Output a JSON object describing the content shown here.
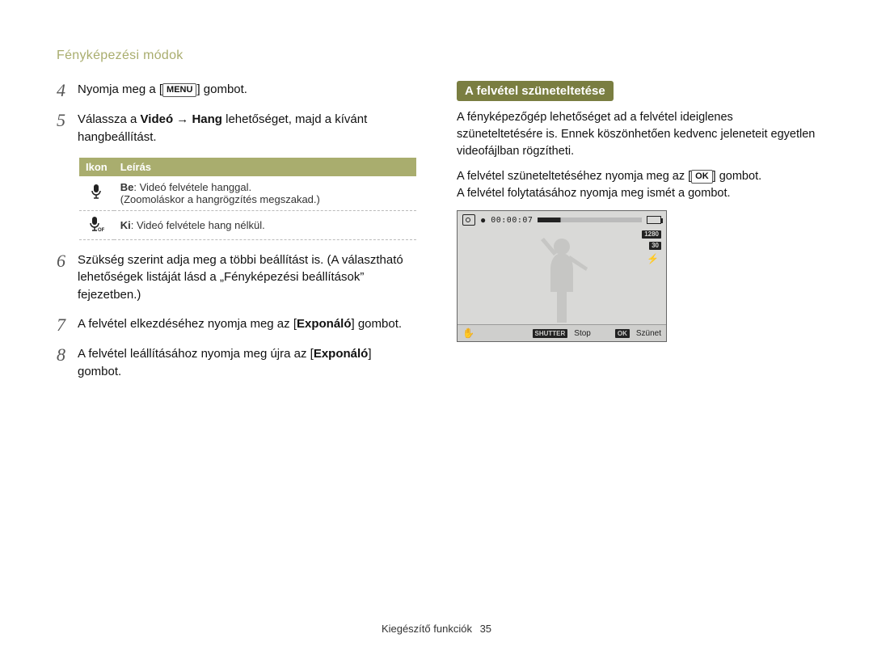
{
  "header": {
    "title": "Fényképezési módok"
  },
  "buttons": {
    "menu": "MENU",
    "ok": "OK"
  },
  "left": {
    "step4": {
      "num": "4",
      "prefix": "Nyomja meg a [",
      "suffix": "] gombot."
    },
    "step5": {
      "num": "5",
      "prefix": "Válassza a ",
      "bold1": "Videó",
      "arrow": " → ",
      "bold2": "Hang",
      "suffix": " lehetőséget, majd a kívánt hangbeállítást."
    },
    "table": {
      "head_icon": "Ikon",
      "head_desc": "Leírás",
      "rows": [
        {
          "icon": "mic-on",
          "bold": "Be",
          "rest": ": Videó felvétele hanggal.",
          "note": "(Zoomoláskor a hangrögzítés megszakad.)"
        },
        {
          "icon": "mic-off",
          "bold": "Ki",
          "rest": ": Videó felvétele hang nélkül."
        }
      ]
    },
    "step6": {
      "num": "6",
      "text": "Szükség szerint adja meg a többi beállítást is. (A választható lehetőségek listáját lásd a „Fényképezési beállítások” fejezetben.)"
    },
    "step7": {
      "num": "7",
      "prefix": "A felvétel elkezdéséhez nyomja meg az [",
      "bold": "Exponáló",
      "suffix": "] gombot."
    },
    "step8": {
      "num": "8",
      "prefix": "A felvétel leállításához nyomja meg újra az [",
      "bold": "Exponáló",
      "suffix": "] gombot."
    }
  },
  "right": {
    "heading": "A felvétel szüneteltetése",
    "para1": "A fényképezőgép lehetőséget ad a felvétel ideiglenes szüneteltetésére is. Ennek köszönhetően kedvenc jeleneteit egyetlen videofájlban rögzítheti.",
    "para2_prefix": "A felvétel szüneteltetéséhez nyomja meg az [",
    "para2_suffix": "] gombot.",
    "para3": "A felvétel folytatásához nyomja meg ismét a gombot."
  },
  "cam": {
    "elapsed": "00:00:07",
    "badges": {
      "res": "1280",
      "fps": "30",
      "flash": "⚡"
    },
    "bottom": {
      "shutter_key": "SHUTTER",
      "shutter_label": "Stop",
      "ok_key": "OK",
      "ok_label": "Szünet"
    }
  },
  "footer": {
    "section": "Kiegészítő funkciók",
    "page": "35"
  }
}
